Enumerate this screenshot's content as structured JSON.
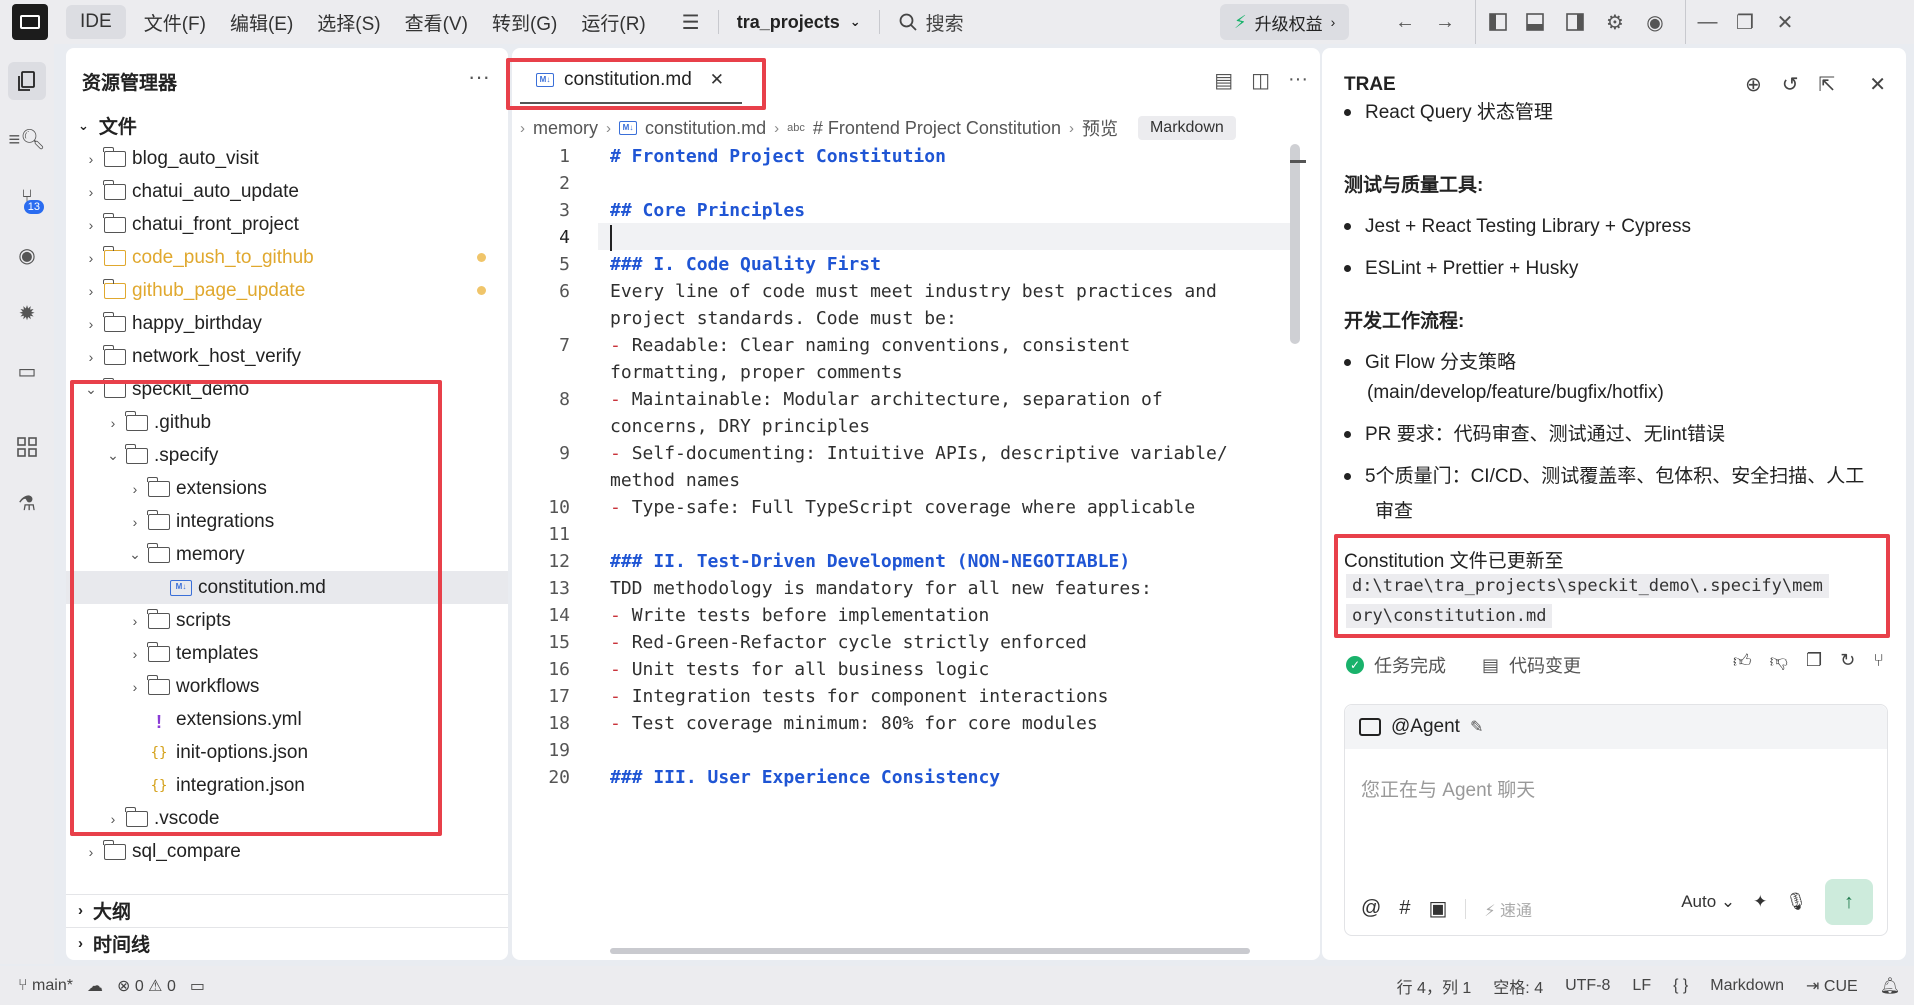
{
  "topbar": {
    "ide_label": "IDE",
    "menus": [
      "文件(F)",
      "编辑(E)",
      "选择(S)",
      "查看(V)",
      "转到(G)",
      "运行(R)"
    ],
    "project": "tra_projects",
    "search": "搜索",
    "upgrade": "升级权益"
  },
  "explorer": {
    "title": "资源管理器",
    "files_section": "文件",
    "items": [
      {
        "label": "blog_auto_visit"
      },
      {
        "label": "chatui_auto_update"
      },
      {
        "label": "chatui_front_project"
      },
      {
        "label": "code_push_to_github"
      },
      {
        "label": "github_page_update"
      },
      {
        "label": "happy_birthday"
      },
      {
        "label": "network_host_verify"
      },
      {
        "label": "speckit_demo"
      },
      {
        "label": ".github"
      },
      {
        "label": ".specify"
      },
      {
        "label": "extensions"
      },
      {
        "label": "integrations"
      },
      {
        "label": "memory"
      },
      {
        "label": "constitution.md"
      },
      {
        "label": "scripts"
      },
      {
        "label": "templates"
      },
      {
        "label": "workflows"
      },
      {
        "label": "extensions.yml"
      },
      {
        "label": "init-options.json"
      },
      {
        "label": "integration.json"
      },
      {
        "label": ".vscode"
      },
      {
        "label": "sql_compare"
      }
    ],
    "outline": "大纲",
    "timeline": "时间线"
  },
  "editor": {
    "tab": "constitution.md",
    "breadcrumb": [
      "memory",
      "constitution.md",
      "# Frontend Project Constitution",
      "预览"
    ],
    "language_chip": "Markdown",
    "lines": [
      {
        "n": "1",
        "t": "# Frontend Project Constitution"
      },
      {
        "n": "2",
        "t": ""
      },
      {
        "n": "3",
        "t": "## Core Principles"
      },
      {
        "n": "4",
        "t": ""
      },
      {
        "n": "5",
        "t": "### I. Code Quality First"
      },
      {
        "n": "6",
        "t": "Every line of code must meet industry best practices and"
      },
      {
        "n": "",
        "t": "project standards. Code must be:"
      },
      {
        "n": "7",
        "t": "Readable: Clear naming conventions, consistent"
      },
      {
        "n": "",
        "t": "formatting, proper comments"
      },
      {
        "n": "8",
        "t": "Maintainable: Modular architecture, separation of"
      },
      {
        "n": "",
        "t": "concerns, DRY principles"
      },
      {
        "n": "9",
        "t": "Self-documenting: Intuitive APIs, descriptive variable/"
      },
      {
        "n": "",
        "t": "method names"
      },
      {
        "n": "10",
        "t": "Type-safe: Full TypeScript coverage where applicable"
      },
      {
        "n": "11",
        "t": ""
      },
      {
        "n": "12",
        "t": "### II. Test-Driven Development (NON-NEGOTIABLE)"
      },
      {
        "n": "13",
        "t": "TDD methodology is mandatory for all new features:"
      },
      {
        "n": "14",
        "t": "Write tests before implementation"
      },
      {
        "n": "15",
        "t": "Red-Green-Refactor cycle strictly enforced"
      },
      {
        "n": "16",
        "t": "Unit tests for all business logic"
      },
      {
        "n": "17",
        "t": "Integration tests for component interactions"
      },
      {
        "n": "18",
        "t": "Test coverage minimum: 80% for core modules"
      },
      {
        "n": "19",
        "t": ""
      },
      {
        "n": "20",
        "t": "### III. User Experience Consistency"
      }
    ]
  },
  "panel": {
    "title": "TRAE",
    "react_query": "React Query 状态管理",
    "h_testing": "测试与质量工具:",
    "testing_items": [
      "Jest + React Testing Library + Cypress",
      "ESLint + Prettier + Husky"
    ],
    "h_workflow": "开发工作流程:",
    "workflow_items": [
      "Git Flow 分支策略",
      "(main/develop/feature/bugfix/hotfix)",
      "PR 要求：代码审查、测试通过、无lint错误",
      "5个质量门：CI/CD、测试覆盖率、包体积、安全扫描、人工",
      "审查"
    ],
    "updated_text": "Constitution 文件已更新至",
    "path_line1": "d:\\trae\\tra_projects\\speckit_demo\\.specify\\mem",
    "path_line2": "ory\\constitution.md",
    "task_done": "任务完成",
    "code_change": "代码变更",
    "agent": "@Agent",
    "placeholder": "您正在与 Agent 聊天",
    "fast": "速通",
    "auto": "Auto"
  },
  "statusbar": {
    "branch": "main*",
    "errors": "0",
    "warnings": "0",
    "position": "行 4，列 1",
    "spaces": "空格: 4",
    "encoding": "UTF-8",
    "eol": "LF",
    "braces": "{ }",
    "language": "Markdown",
    "cue": "CUE"
  },
  "colors": {
    "highlight": "#e8404a",
    "heading": "#1f55d4",
    "list_dash": "#c9333b",
    "modified": "#e0a82e"
  }
}
